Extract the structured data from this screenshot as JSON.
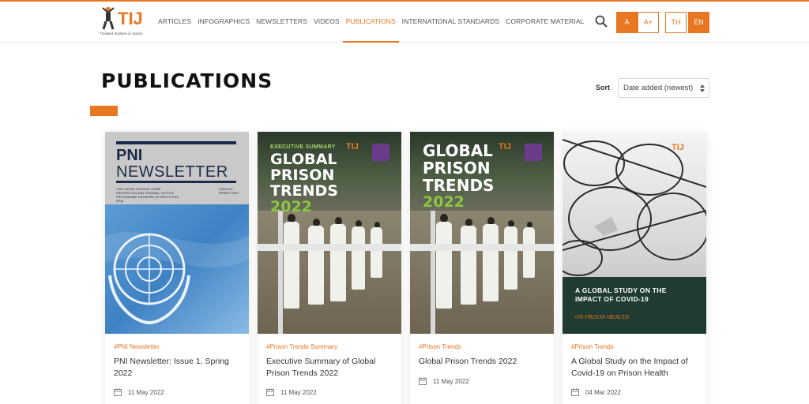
{
  "header": {
    "logo_text": "TIJ",
    "logo_subtitle": "Thailand Institute of Justice",
    "nav": [
      {
        "label": "ARTICLES",
        "active": false
      },
      {
        "label": "INFOGRAPHICS",
        "active": false
      },
      {
        "label": "NEWSLETTERS",
        "active": false
      },
      {
        "label": "VIDEOS",
        "active": false
      },
      {
        "label": "PUBLICATIONS",
        "active": true
      },
      {
        "label": "INTERNATIONAL STANDARDS",
        "active": false
      },
      {
        "label": "CORPORATE MATERIAL",
        "active": false
      }
    ],
    "font_small": "A",
    "font_large": "A+",
    "lang_th": "TH",
    "lang_en": "EN",
    "search_icon": "search-icon"
  },
  "page": {
    "title": "PUBLICATIONS",
    "sort_label": "Sort",
    "sort_value": "Date added (newest)"
  },
  "colors": {
    "accent": "#e87722",
    "cover_green": "#203b32",
    "trend_green": "#8dc63f"
  },
  "cards": [
    {
      "tag": "#PNI Newsletter",
      "title": "PNI Newsletter: Issue 1, Spring 2022",
      "date": "11 May 2022",
      "cover": {
        "line1": "PNI",
        "line2": "NEWSLETTER",
        "subtitle": "THE UNITED NATIONS CRIME PREVENTION AND CRIMINAL JUSTICE PROGRAMME NETWORK OF INSTITUTES (PNI)",
        "issue": "ISSUE 01 SPRING 2022"
      }
    },
    {
      "tag": "#Prison Trends Summary",
      "title": "Executive Summary of Global Prison Trends 2022",
      "date": "11 May 2022",
      "cover": {
        "kicker": "EXECUTIVE SUMMARY",
        "line1": "GLOBAL",
        "line2": "PRISON",
        "line3": "TRENDS",
        "year": "2022",
        "logo": "TIJ"
      }
    },
    {
      "tag": "#Prison Trends",
      "title": "Global Prison Trends 2022",
      "date": "11 May 2022",
      "cover": {
        "line1": "GLOBAL",
        "line2": "PRISON",
        "line3": "TRENDS",
        "year": "2022",
        "logo": "TIJ"
      }
    },
    {
      "tag": "#Prison Trends",
      "title": "A Global Study on the Impact of Covid-19 on Prison Health",
      "date": "04 Mar 2022",
      "cover": {
        "heading": "A GLOBAL STUDY ON THE IMPACT OF COVID-19",
        "sub": "ON PRISON HEALTH",
        "logo": "TIJ"
      }
    }
  ]
}
